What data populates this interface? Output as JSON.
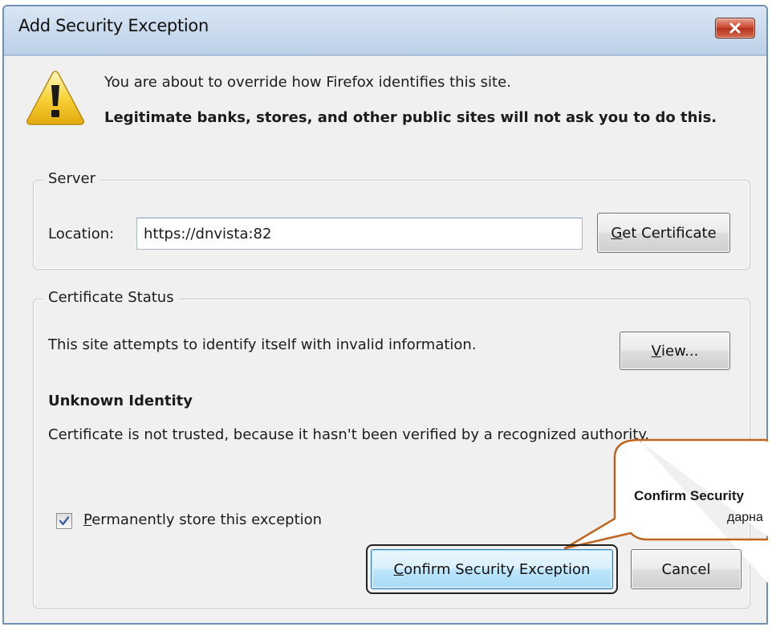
{
  "window": {
    "title": "Add Security Exception"
  },
  "warning": {
    "line1": "You are about to override how Firefox identifies this site.",
    "line2": "Legitimate banks, stores, and other public sites will not ask you to do this."
  },
  "server": {
    "legend": "Server",
    "location_label": "Location:",
    "location_value": "https://dnvista:82",
    "get_certificate_prefix": "",
    "get_certificate_mnemonic": "G",
    "get_certificate_rest": "et Certificate"
  },
  "cert_status": {
    "legend": "Certificate Status",
    "description": "This site attempts to identify itself with invalid information.",
    "view_mnemonic": "V",
    "view_rest": "iew...",
    "identity_heading": "Unknown Identity",
    "identity_detail": "Certificate is not trusted, because it hasn't been verified by a recognized authority.",
    "permanent_mnemonic": "P",
    "permanent_rest": "ermanently store this exception",
    "permanent_checked": true
  },
  "buttons": {
    "confirm_mnemonic": "C",
    "confirm_rest": "onfirm Security Exception",
    "cancel": "Cancel"
  },
  "callout": {
    "line1": "Confirm Security",
    "line2": "дарна"
  },
  "icons": {
    "warning": "warning-triangle-icon",
    "close": "close-icon",
    "check": "checkmark-icon"
  },
  "colors": {
    "callout_border": "#c0651e",
    "close_button": "#c9412a",
    "warning_yellow": "#f5c518"
  }
}
